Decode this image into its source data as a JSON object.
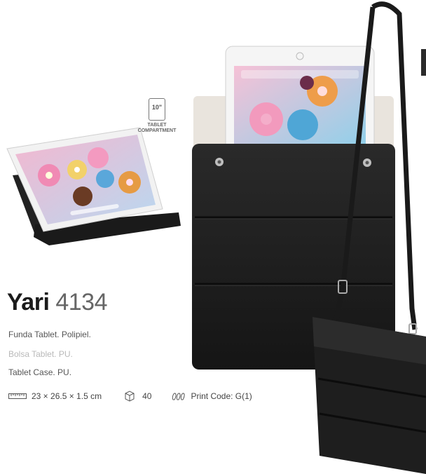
{
  "product": {
    "name": "Yari",
    "code": "4134",
    "descriptions": [
      "Funda Tablet. Polipiel.",
      "Bolsa Tablet. PU.",
      "Tablet Case. PU."
    ]
  },
  "badge": {
    "size": "10\"",
    "line1": "TABLET",
    "line2": "COMPARTMENT"
  },
  "specs": {
    "dimensions": "23 × 26.5 × 1.5 cm",
    "quantity": "40",
    "print_code": "Print Code: G(1)"
  },
  "colors": {
    "case": "#1c1c1c",
    "accent": "#2b2b2b",
    "muted_text": "#b9b9b9"
  },
  "icons": [
    "ruler-icon",
    "box-icon",
    "print-icon",
    "tablet-icon"
  ]
}
